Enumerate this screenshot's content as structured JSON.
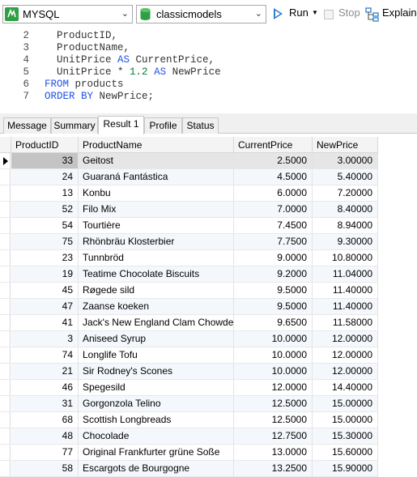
{
  "toolbar": {
    "connection": "MYSQL",
    "database": "classicmodels",
    "run_label": "Run",
    "stop_label": "Stop",
    "explain_label": "Explain"
  },
  "editor": {
    "lines": [
      {
        "n": "2",
        "parts": [
          {
            "t": "  ProductID,",
            "c": "plain"
          }
        ]
      },
      {
        "n": "3",
        "parts": [
          {
            "t": "  ProductName,",
            "c": "plain"
          }
        ]
      },
      {
        "n": "4",
        "parts": [
          {
            "t": "  UnitPrice ",
            "c": "plain"
          },
          {
            "t": "AS",
            "c": "kw"
          },
          {
            "t": " CurrentPrice,",
            "c": "plain"
          }
        ]
      },
      {
        "n": "5",
        "parts": [
          {
            "t": "  UnitPrice * ",
            "c": "plain"
          },
          {
            "t": "1.2",
            "c": "num"
          },
          {
            "t": " ",
            "c": "plain"
          },
          {
            "t": "AS",
            "c": "kw"
          },
          {
            "t": " NewPrice",
            "c": "plain"
          }
        ]
      },
      {
        "n": "6",
        "parts": [
          {
            "t": "FROM",
            "c": "kw"
          },
          {
            "t": " products",
            "c": "plain"
          }
        ]
      },
      {
        "n": "7",
        "parts": [
          {
            "t": "ORDER BY",
            "c": "kw"
          },
          {
            "t": " NewPrice;",
            "c": "plain"
          }
        ]
      }
    ]
  },
  "tabs": [
    "Message",
    "Summary",
    "Result 1",
    "Profile",
    "Status"
  ],
  "active_tab": "Result 1",
  "grid": {
    "columns": [
      "ProductID",
      "ProductName",
      "CurrentPrice",
      "NewPrice"
    ],
    "rows": [
      [
        "33",
        "Geitost",
        "2.5000",
        "3.00000"
      ],
      [
        "24",
        "Guaraná Fantástica",
        "4.5000",
        "5.40000"
      ],
      [
        "13",
        "Konbu",
        "6.0000",
        "7.20000"
      ],
      [
        "52",
        "Filo Mix",
        "7.0000",
        "8.40000"
      ],
      [
        "54",
        "Tourtière",
        "7.4500",
        "8.94000"
      ],
      [
        "75",
        "Rhönbräu Klosterbier",
        "7.7500",
        "9.30000"
      ],
      [
        "23",
        "Tunnbröd",
        "9.0000",
        "10.80000"
      ],
      [
        "19",
        "Teatime Chocolate Biscuits",
        "9.2000",
        "11.04000"
      ],
      [
        "45",
        "Røgede sild",
        "9.5000",
        "11.40000"
      ],
      [
        "47",
        "Zaanse koeken",
        "9.5000",
        "11.40000"
      ],
      [
        "41",
        "Jack's New England Clam Chowde",
        "9.6500",
        "11.58000"
      ],
      [
        "3",
        "Aniseed Syrup",
        "10.0000",
        "12.00000"
      ],
      [
        "74",
        "Longlife Tofu",
        "10.0000",
        "12.00000"
      ],
      [
        "21",
        "Sir Rodney's Scones",
        "10.0000",
        "12.00000"
      ],
      [
        "46",
        "Spegesild",
        "12.0000",
        "14.40000"
      ],
      [
        "31",
        "Gorgonzola Telino",
        "12.5000",
        "15.00000"
      ],
      [
        "68",
        "Scottish Longbreads",
        "12.5000",
        "15.00000"
      ],
      [
        "48",
        "Chocolade",
        "12.7500",
        "15.30000"
      ],
      [
        "77",
        "Original Frankfurter grüne Soße",
        "13.0000",
        "15.60000"
      ],
      [
        "58",
        "Escargots de Bourgogne",
        "13.2500",
        "15.90000"
      ]
    ],
    "selected_row": 0
  },
  "colors": {
    "keyword": "#2050e8",
    "number": "#007f35",
    "run_icon": "#2f7fd1",
    "db_icon": "#2ea043",
    "alt_row": "#f4f8fd"
  },
  "icons": {
    "connection": "mysql-connection-icon",
    "database": "database-icon",
    "run": "play-icon",
    "stop": "stop-icon",
    "explain": "explain-icon",
    "row_pointer": "row-pointer-icon"
  }
}
